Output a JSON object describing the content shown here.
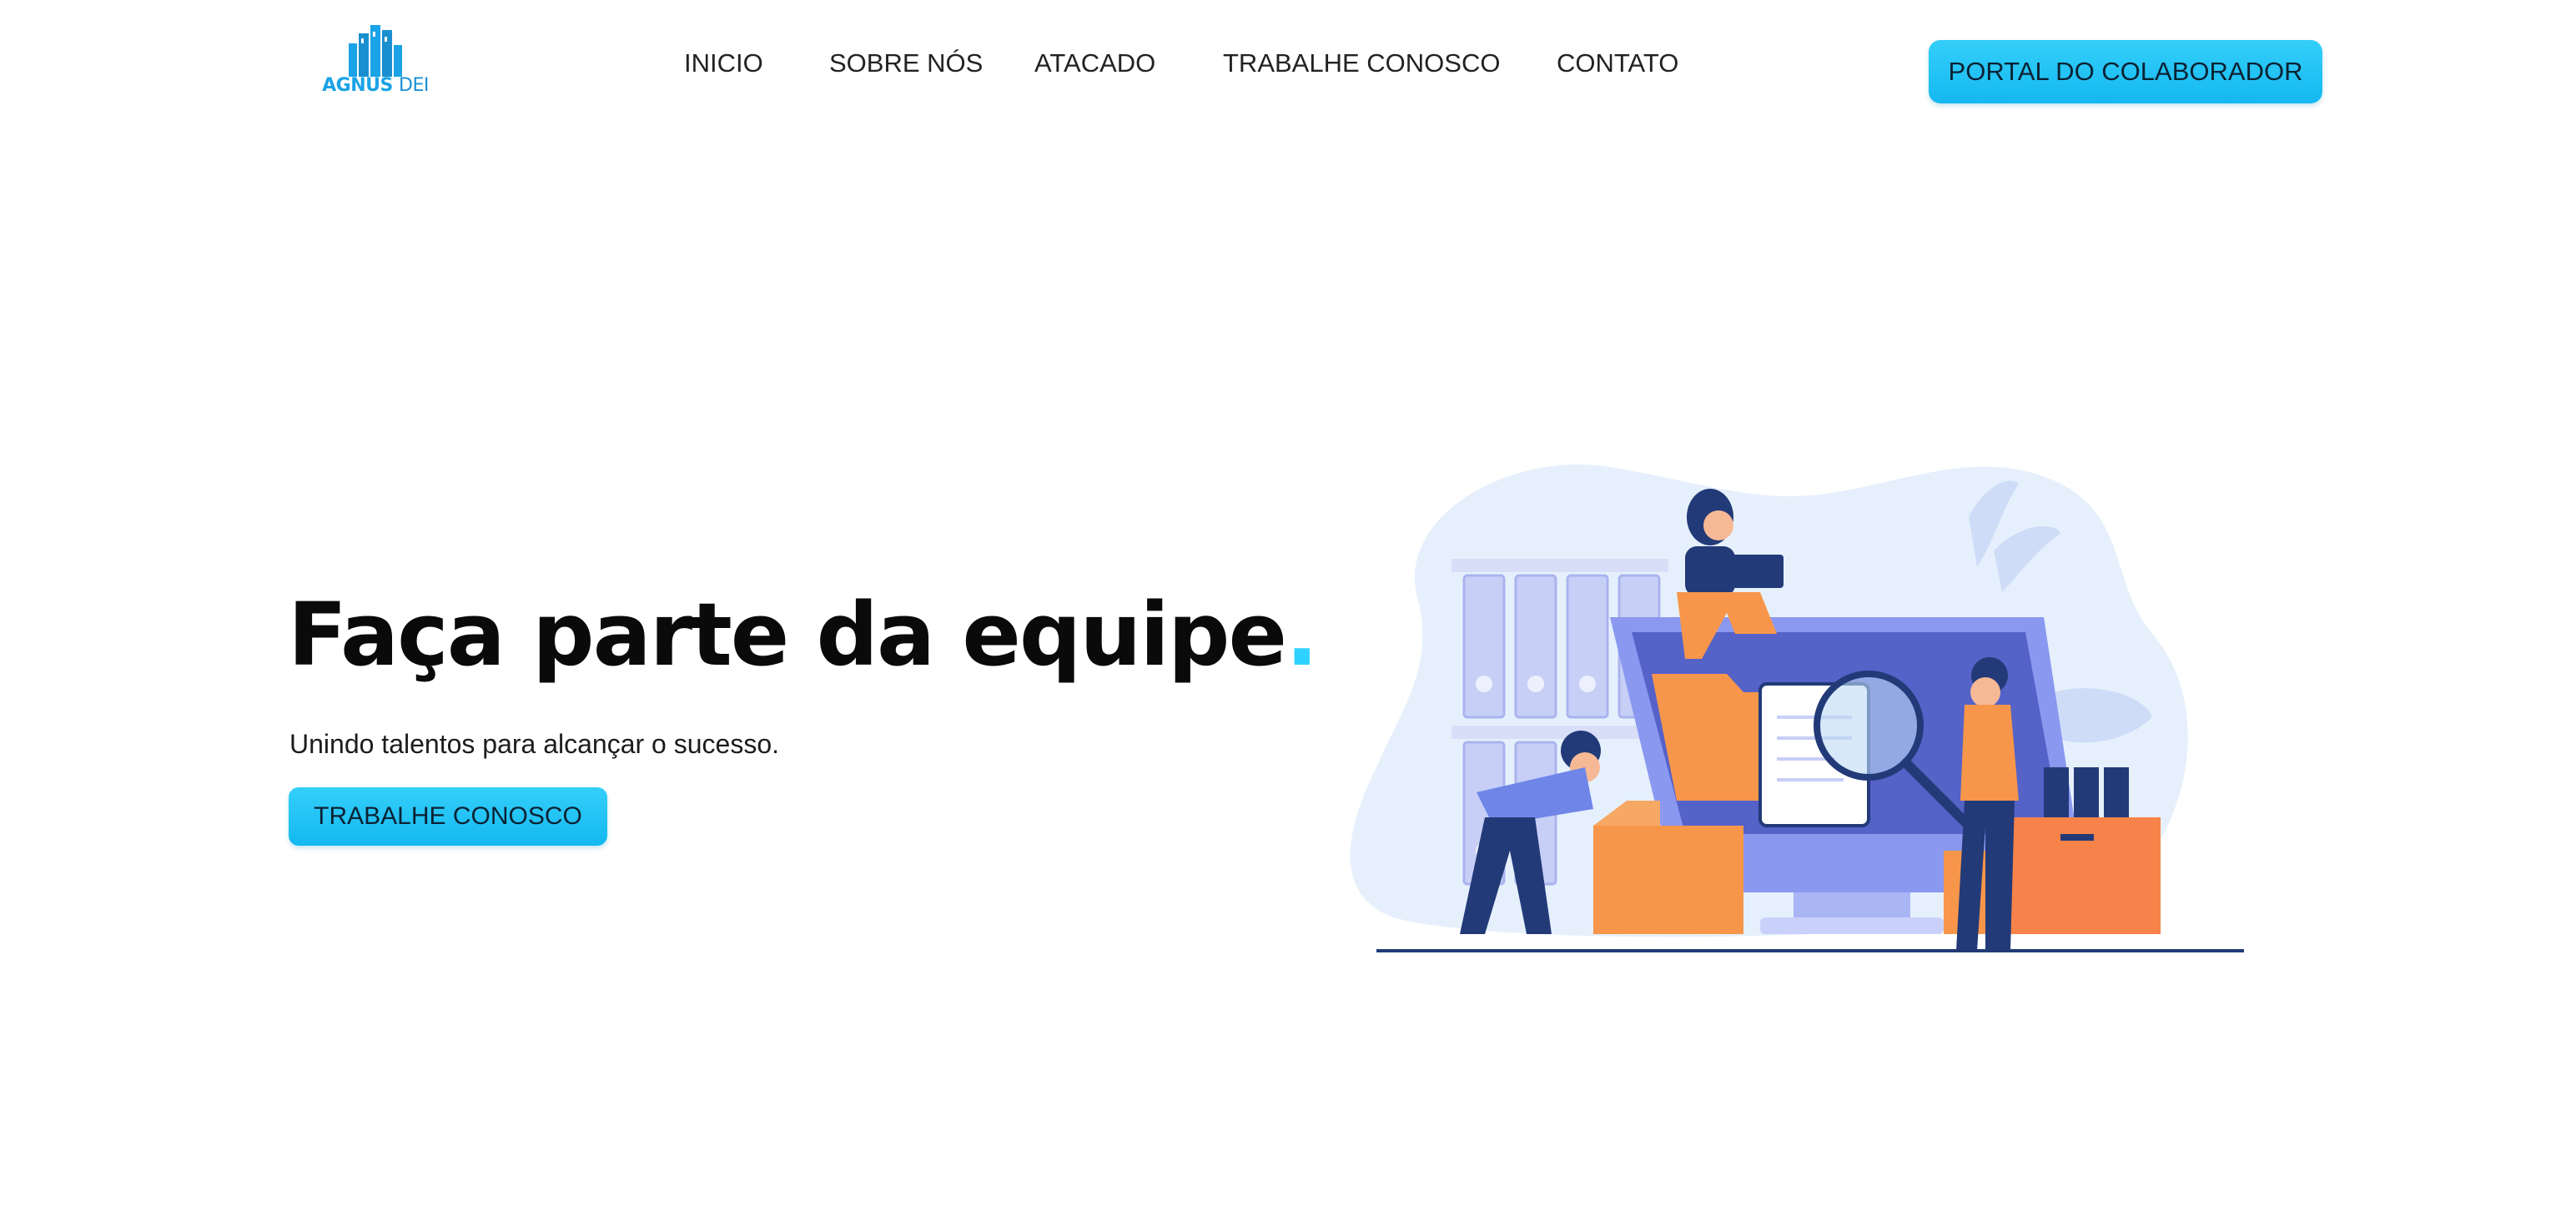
{
  "brand": {
    "name_primary": "AGNUS",
    "name_secondary": "DEI",
    "accent_color": "#1aa3e6"
  },
  "nav": {
    "items": [
      {
        "label": "INICIO"
      },
      {
        "label": "SOBRE NÓS"
      },
      {
        "label": "ATACADO"
      },
      {
        "label": "TRABALHE CONOSCO"
      },
      {
        "label": "CONTATO"
      }
    ],
    "portal_button": "PORTAL DO COLABORADOR"
  },
  "hero": {
    "title": "Faça parte da equipe",
    "title_dot": ".",
    "subtitle": "Unindo talentos para alcançar o sucesso.",
    "cta_label": "TRABALHE CONOSCO",
    "button_color": "#1ec3f5"
  },
  "illustration": {
    "icon": "team-recruitment-illustration",
    "colors": {
      "blob": "#e6f0fc",
      "monitor": "#8a98f0",
      "orange": "#f7964a",
      "navy": "#223a78",
      "shelf": "#c7cff7"
    }
  }
}
